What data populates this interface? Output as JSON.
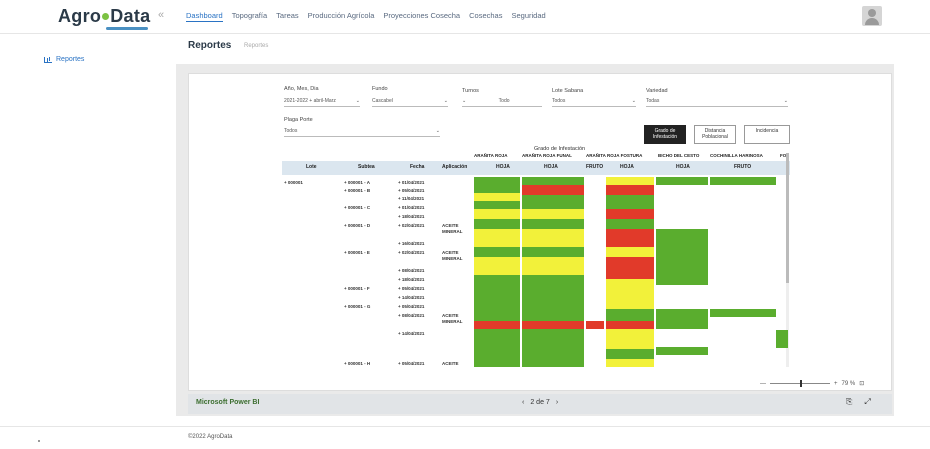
{
  "brand": {
    "part1": "Agro",
    "part2": "Data"
  },
  "nav": {
    "collapse_glyph": "«",
    "items": [
      "Dashboard",
      "Topografía",
      "Tareas",
      "Producción Agrícola",
      "Proyecciones Cosecha",
      "Cosechas",
      "Seguridad"
    ]
  },
  "sidebar": {
    "items": [
      {
        "label": "Reportes",
        "icon": "chart-icon"
      }
    ]
  },
  "page": {
    "title": "Reportes",
    "subtitle": "Reportes"
  },
  "filters": [
    {
      "label": "Año, Mes, Dia",
      "value": "2021-2022 + abril-Marz"
    },
    {
      "label": "Fundo",
      "value": "Cascabel"
    },
    {
      "label": "Turnos",
      "value": "Todo"
    },
    {
      "label": "Lote Sabana",
      "value": "Todos"
    },
    {
      "label": "Variedad",
      "value": "Todas"
    },
    {
      "label": "Plaga Porte",
      "value": "Todos"
    }
  ],
  "buttons": {
    "b1": "Grado de Infestación",
    "b2": "Distancia Poblacional",
    "b3": "Incidencia"
  },
  "grid": {
    "group_header": "Grado de Infestación",
    "columns": [
      "Lote",
      "Subtea",
      "Fecha",
      "Aplicación"
    ],
    "measures": [
      "ARAÑITA ROJA",
      "ARAÑITA ROJA FUNAL",
      "ARAÑITA ROJA FOSTURA",
      "BICHO DEL CESTO",
      "COCHINILLA HARINOSA",
      "FOS"
    ],
    "subheaders": [
      "HOJA",
      "HOJA",
      "FRUTO",
      "HOJA",
      "HOJA",
      "FRUTO"
    ],
    "rows": [
      {
        "lote": "+ 000001",
        "sub": "+ 000001 - A",
        "fecha": "+ 01/04/2021",
        "apl": ""
      },
      {
        "lote": "",
        "sub": "+ 000001 - B",
        "fecha": "+ 05/04/2021",
        "apl": ""
      },
      {
        "lote": "",
        "sub": "",
        "fecha": "+ 11/04/2021",
        "apl": ""
      },
      {
        "lote": "",
        "sub": "+ 000001 - C",
        "fecha": "+ 01/04/2021",
        "apl": ""
      },
      {
        "lote": "",
        "sub": "",
        "fecha": "+ 18/04/2021",
        "apl": ""
      },
      {
        "lote": "",
        "sub": "+ 000001 - D",
        "fecha": "+ 02/04/2021",
        "apl": "ACEITE MINERAL"
      },
      {
        "lote": "",
        "sub": "",
        "fecha": "+ 16/04/2021",
        "apl": ""
      },
      {
        "lote": "",
        "sub": "+ 000001 - E",
        "fecha": "+ 02/04/2021",
        "apl": "ACEITE MINERAL"
      },
      {
        "lote": "",
        "sub": "",
        "fecha": "+ 08/04/2021",
        "apl": ""
      },
      {
        "lote": "",
        "sub": "",
        "fecha": "+ 18/04/2021",
        "apl": ""
      },
      {
        "lote": "",
        "sub": "+ 000001 - F",
        "fecha": "+ 05/04/2021",
        "apl": ""
      },
      {
        "lote": "",
        "sub": "",
        "fecha": "+ 14/04/2021",
        "apl": ""
      },
      {
        "lote": "",
        "sub": "+ 000001 - G",
        "fecha": "+ 05/04/2021",
        "apl": ""
      },
      {
        "lote": "",
        "sub": "",
        "fecha": "+ 08/04/2021",
        "apl": "ACEITE MINERAL"
      },
      {
        "lote": "",
        "sub": "",
        "fecha": "+ 14/04/2021",
        "apl": ""
      },
      {
        "lote": "",
        "sub": "+ 000001 - H",
        "fecha": "+ 05/04/2021",
        "apl": "ACEITE"
      }
    ]
  },
  "zoom": {
    "minus": "—",
    "plus": "+",
    "value": "79 %"
  },
  "footer": {
    "pbi": "Microsoft Power BI",
    "prev": "‹",
    "page": "2 de 7",
    "next": "›"
  },
  "copyright": "©2022 AgroData",
  "colors": {
    "green": "#5aad2e",
    "yellow": "#f2f13a",
    "red": "#e13a2a",
    "accent": "#2a73c4"
  }
}
